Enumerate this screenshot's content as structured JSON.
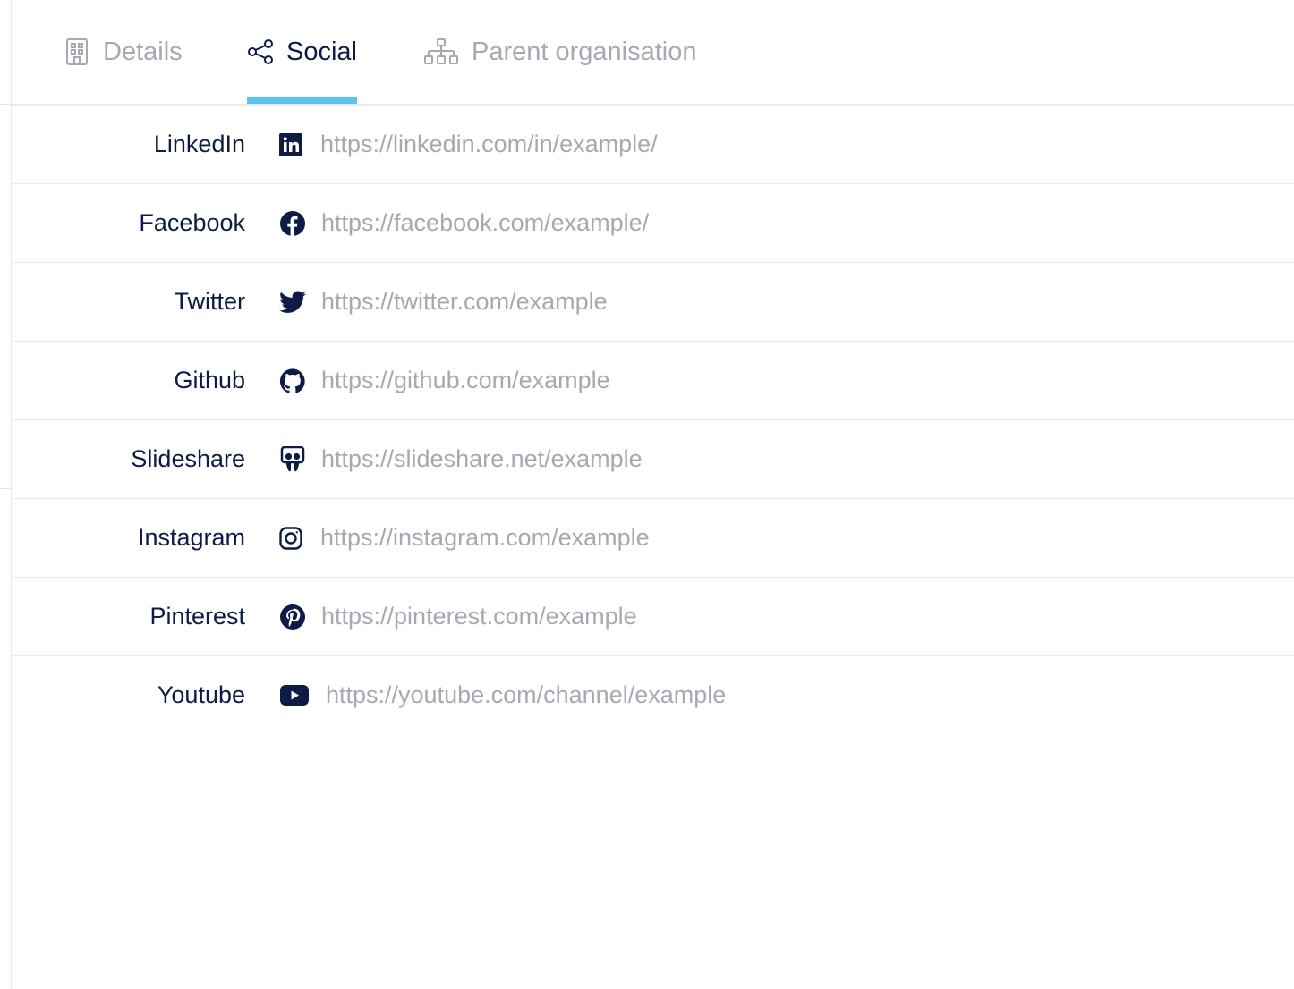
{
  "colors": {
    "accent": "#5ac3f0",
    "text_dark": "#0d1b46",
    "text_muted": "#a6a9b2",
    "divider": "#e8e9ec"
  },
  "tabs": [
    {
      "label": "Details",
      "icon": "building-icon",
      "active": false
    },
    {
      "label": "Social",
      "icon": "share-icon",
      "active": true
    },
    {
      "label": "Parent organisation",
      "icon": "org-chart-icon",
      "active": false
    }
  ],
  "social": {
    "rows": [
      {
        "label": "LinkedIn",
        "icon": "linkedin-icon",
        "value": "",
        "placeholder": "https://linkedin.com/in/example/"
      },
      {
        "label": "Facebook",
        "icon": "facebook-icon",
        "value": "",
        "placeholder": "https://facebook.com/example/"
      },
      {
        "label": "Twitter",
        "icon": "twitter-icon",
        "value": "",
        "placeholder": "https://twitter.com/example"
      },
      {
        "label": "Github",
        "icon": "github-icon",
        "value": "",
        "placeholder": "https://github.com/example"
      },
      {
        "label": "Slideshare",
        "icon": "slideshare-icon",
        "value": "",
        "placeholder": "https://slideshare.net/example"
      },
      {
        "label": "Instagram",
        "icon": "instagram-icon",
        "value": "",
        "placeholder": "https://instagram.com/example"
      },
      {
        "label": "Pinterest",
        "icon": "pinterest-icon",
        "value": "",
        "placeholder": "https://pinterest.com/example"
      },
      {
        "label": "Youtube",
        "icon": "youtube-icon",
        "value": "",
        "placeholder": "https://youtube.com/channel/example"
      }
    ]
  }
}
